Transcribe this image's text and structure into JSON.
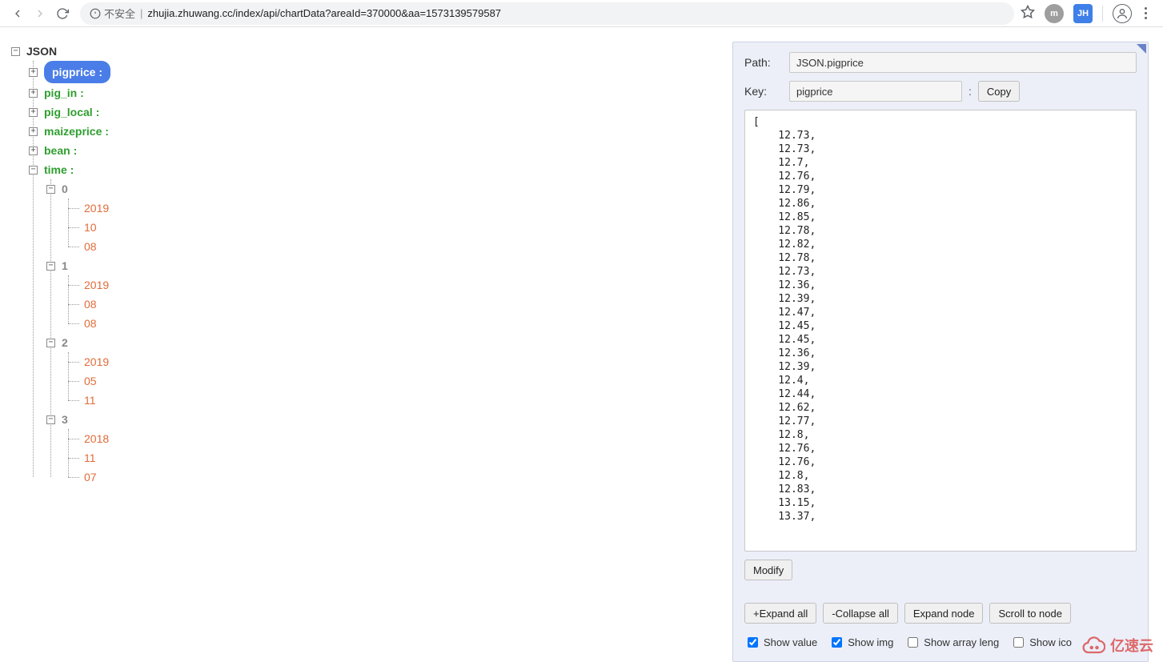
{
  "browser": {
    "insecure_label": "不安全",
    "url": "zhujia.zhuwang.cc/index/api/chartData?areaId=370000&aa=1573139579587",
    "ext_m": "m",
    "ext_jh": "JH"
  },
  "tree": {
    "root": "JSON",
    "nodes": [
      {
        "label": "pigprice :",
        "selected": true
      },
      {
        "label": "pig_in :"
      },
      {
        "label": "pig_local :"
      },
      {
        "label": "maizeprice :"
      },
      {
        "label": "bean :"
      },
      {
        "label": "time :",
        "expanded": true,
        "children": [
          {
            "idx": "0",
            "vals": [
              "2019",
              "10",
              "08"
            ]
          },
          {
            "idx": "1",
            "vals": [
              "2019",
              "08",
              "08"
            ]
          },
          {
            "idx": "2",
            "vals": [
              "2019",
              "05",
              "11"
            ]
          },
          {
            "idx": "3",
            "vals": [
              "2018",
              "11",
              "07"
            ]
          }
        ]
      }
    ]
  },
  "panel": {
    "path_label": "Path:",
    "path_value": "JSON.pigprice",
    "key_label": "Key:",
    "key_value": "pigprice",
    "colon": ":",
    "copy": "Copy",
    "code": "[\n    12.73,\n    12.73,\n    12.7,\n    12.76,\n    12.79,\n    12.86,\n    12.85,\n    12.78,\n    12.82,\n    12.78,\n    12.73,\n    12.36,\n    12.39,\n    12.47,\n    12.45,\n    12.45,\n    12.36,\n    12.39,\n    12.4,\n    12.44,\n    12.62,\n    12.77,\n    12.8,\n    12.76,\n    12.76,\n    12.8,\n    12.83,\n    13.15,\n    13.37,",
    "modify": "Modify",
    "expand_all": "+Expand all",
    "collapse_all": "-Collapse all",
    "expand_node": "Expand node",
    "scroll_node": "Scroll to node",
    "show_value": "Show value",
    "show_img": "Show img",
    "show_array_len": "Show array leng",
    "show_ico": "Show ico"
  },
  "watermark": "亿速云"
}
